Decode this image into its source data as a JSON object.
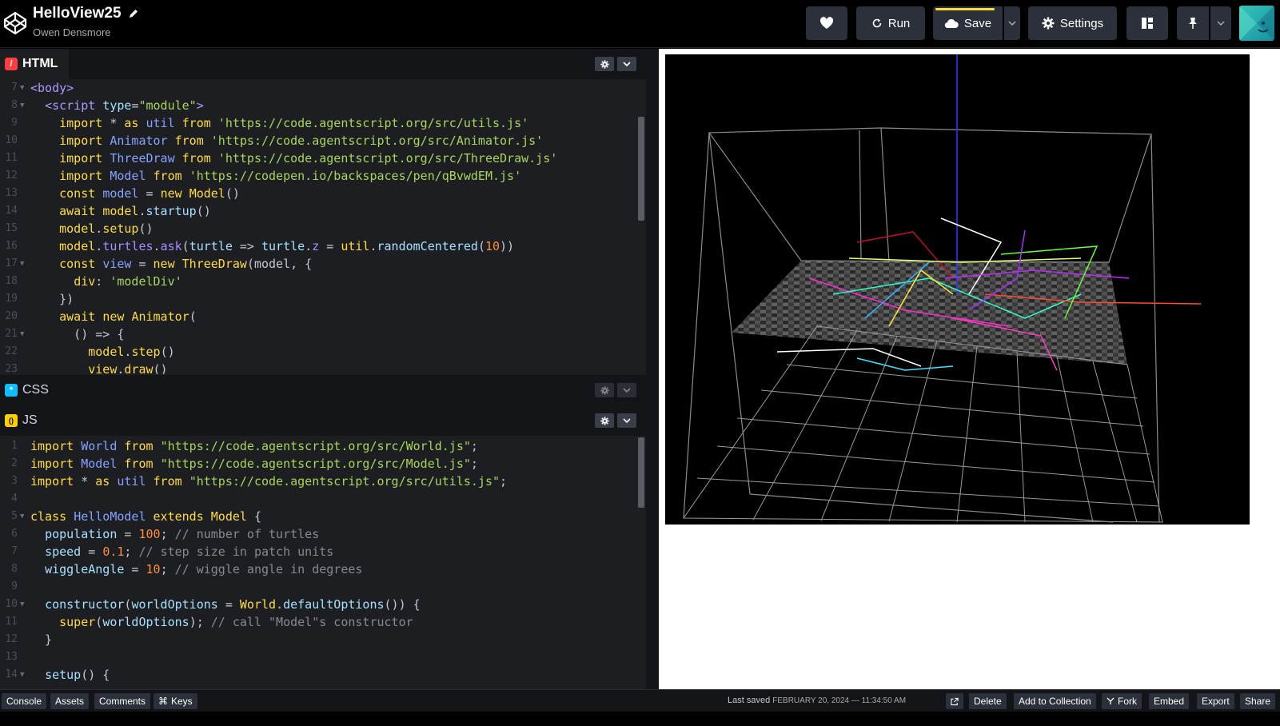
{
  "header": {
    "title": "HelloView25",
    "author": "Owen Densmore",
    "run_label": "Run",
    "save_label": "Save",
    "settings_label": "Settings"
  },
  "panes": {
    "html": {
      "label": "HTML",
      "badge": "/"
    },
    "css": {
      "label": "CSS",
      "badge": "*"
    },
    "js": {
      "label": "JS",
      "badge": "()"
    }
  },
  "html_lines": [
    {
      "n": "7",
      "fold": true,
      "t": [
        [
          "tg",
          "<body>"
        ]
      ]
    },
    {
      "n": "8",
      "fold": true,
      "t": [
        [
          "op",
          "  "
        ],
        [
          "tg",
          "<script "
        ],
        [
          "pr",
          "type"
        ],
        [
          "op",
          "="
        ],
        [
          "st",
          "\"module\""
        ],
        [
          "tg",
          ">"
        ]
      ]
    },
    {
      "n": "9",
      "t": [
        [
          "op",
          "    "
        ],
        [
          "kw",
          "import"
        ],
        [
          "op",
          " * "
        ],
        [
          "kw",
          "as"
        ],
        [
          "op",
          " "
        ],
        [
          "ty",
          "util"
        ],
        [
          "op",
          " "
        ],
        [
          "kw",
          "from"
        ],
        [
          "op",
          " "
        ],
        [
          "st",
          "'https://code.agentscript.org/src/utils.js'"
        ]
      ]
    },
    {
      "n": "10",
      "t": [
        [
          "op",
          "    "
        ],
        [
          "kw",
          "import"
        ],
        [
          "op",
          " "
        ],
        [
          "ty",
          "Animator"
        ],
        [
          "op",
          " "
        ],
        [
          "kw",
          "from"
        ],
        [
          "op",
          " "
        ],
        [
          "st",
          "'https://code.agentscript.org/src/Animator.js'"
        ]
      ]
    },
    {
      "n": "11",
      "t": [
        [
          "op",
          "    "
        ],
        [
          "kw",
          "import"
        ],
        [
          "op",
          " "
        ],
        [
          "ty",
          "ThreeDraw"
        ],
        [
          "op",
          " "
        ],
        [
          "kw",
          "from"
        ],
        [
          "op",
          " "
        ],
        [
          "st",
          "'https://code.agentscript.org/src/ThreeDraw.js'"
        ]
      ]
    },
    {
      "n": "12",
      "t": [
        [
          "op",
          "    "
        ],
        [
          "kw",
          "import"
        ],
        [
          "op",
          " "
        ],
        [
          "ty",
          "Model"
        ],
        [
          "op",
          " "
        ],
        [
          "kw",
          "from"
        ],
        [
          "op",
          " "
        ],
        [
          "st",
          "'https://codepen.io/backspaces/pen/qBvwdEM.js'"
        ]
      ]
    },
    {
      "n": "13",
      "t": [
        [
          "op",
          "    "
        ],
        [
          "kw",
          "const"
        ],
        [
          "op",
          " "
        ],
        [
          "ty",
          "model"
        ],
        [
          "op",
          " = "
        ],
        [
          "kw",
          "new"
        ],
        [
          "op",
          " "
        ],
        [
          "kw",
          "Model"
        ],
        [
          "op",
          "()"
        ]
      ]
    },
    {
      "n": "14",
      "t": [
        [
          "op",
          "    "
        ],
        [
          "kw",
          "await"
        ],
        [
          "op",
          " "
        ],
        [
          "kw",
          "model"
        ],
        [
          "op",
          "."
        ],
        [
          "pr",
          "startup"
        ],
        [
          "op",
          "()"
        ]
      ]
    },
    {
      "n": "15",
      "t": [
        [
          "op",
          "    "
        ],
        [
          "kw",
          "model"
        ],
        [
          "op",
          "."
        ],
        [
          "kw",
          "setup"
        ],
        [
          "op",
          "()"
        ]
      ]
    },
    {
      "n": "16",
      "t": [
        [
          "op",
          "    "
        ],
        [
          "kw",
          "model"
        ],
        [
          "op",
          "."
        ],
        [
          "id",
          "turtles"
        ],
        [
          "op",
          "."
        ],
        [
          "id",
          "ask"
        ],
        [
          "op",
          "("
        ],
        [
          "pr",
          "turtle"
        ],
        [
          "op",
          " => "
        ],
        [
          "pr",
          "turtle"
        ],
        [
          "op",
          "."
        ],
        [
          "id",
          "z"
        ],
        [
          "op",
          " = "
        ],
        [
          "kw",
          "util"
        ],
        [
          "op",
          "."
        ],
        [
          "pr",
          "randomCentered"
        ],
        [
          "op",
          "("
        ],
        [
          "nu",
          "10"
        ],
        [
          "op",
          "))"
        ]
      ]
    },
    {
      "n": "17",
      "fold": true,
      "t": [
        [
          "op",
          "    "
        ],
        [
          "kw",
          "const"
        ],
        [
          "op",
          " "
        ],
        [
          "ty",
          "view"
        ],
        [
          "op",
          " = "
        ],
        [
          "kw",
          "new"
        ],
        [
          "op",
          " "
        ],
        [
          "kw",
          "ThreeDraw"
        ],
        [
          "op",
          "(model, {"
        ]
      ]
    },
    {
      "n": "18",
      "t": [
        [
          "op",
          "      "
        ],
        [
          "kw",
          "div"
        ],
        [
          "op",
          ": "
        ],
        [
          "st",
          "'modelDiv'"
        ]
      ]
    },
    {
      "n": "19",
      "t": [
        [
          "op",
          "    })"
        ]
      ]
    },
    {
      "n": "20",
      "t": [
        [
          "op",
          "    "
        ],
        [
          "kw",
          "await"
        ],
        [
          "op",
          " "
        ],
        [
          "kw",
          "new"
        ],
        [
          "op",
          " "
        ],
        [
          "kw",
          "Animator"
        ],
        [
          "op",
          "("
        ]
      ]
    },
    {
      "n": "21",
      "fold": true,
      "t": [
        [
          "op",
          "      () => {"
        ]
      ]
    },
    {
      "n": "22",
      "t": [
        [
          "op",
          "        "
        ],
        [
          "kw",
          "model"
        ],
        [
          "op",
          "."
        ],
        [
          "kw",
          "step"
        ],
        [
          "op",
          "()"
        ]
      ]
    },
    {
      "n": "23",
      "t": [
        [
          "op",
          "        "
        ],
        [
          "kw",
          "view"
        ],
        [
          "op",
          "."
        ],
        [
          "kw",
          "draw"
        ],
        [
          "op",
          "()"
        ]
      ]
    }
  ],
  "js_lines": [
    {
      "n": "1",
      "t": [
        [
          "kw",
          "import"
        ],
        [
          "op",
          " "
        ],
        [
          "ty",
          "World"
        ],
        [
          "op",
          " "
        ],
        [
          "kw",
          "from"
        ],
        [
          "op",
          " "
        ],
        [
          "st",
          "\"https://code.agentscript.org/src/World.js\""
        ],
        [
          "op",
          ";"
        ]
      ]
    },
    {
      "n": "2",
      "t": [
        [
          "kw",
          "import"
        ],
        [
          "op",
          " "
        ],
        [
          "ty",
          "Model"
        ],
        [
          "op",
          " "
        ],
        [
          "kw",
          "from"
        ],
        [
          "op",
          " "
        ],
        [
          "st",
          "\"https://code.agentscript.org/src/Model.js\""
        ],
        [
          "op",
          ";"
        ]
      ]
    },
    {
      "n": "3",
      "t": [
        [
          "kw",
          "import"
        ],
        [
          "op",
          " * "
        ],
        [
          "kw",
          "as"
        ],
        [
          "op",
          " "
        ],
        [
          "ty",
          "util"
        ],
        [
          "op",
          " "
        ],
        [
          "kw",
          "from"
        ],
        [
          "op",
          " "
        ],
        [
          "st",
          "\"https://code.agentscript.org/src/utils.js\""
        ],
        [
          "op",
          ";"
        ]
      ]
    },
    {
      "n": "4",
      "t": []
    },
    {
      "n": "5",
      "fold": true,
      "t": [
        [
          "kw",
          "class"
        ],
        [
          "op",
          " "
        ],
        [
          "ty",
          "HelloModel"
        ],
        [
          "op",
          " "
        ],
        [
          "kw",
          "extends"
        ],
        [
          "op",
          " "
        ],
        [
          "kw",
          "Model"
        ],
        [
          "op",
          " {"
        ]
      ]
    },
    {
      "n": "6",
      "t": [
        [
          "op",
          "  "
        ],
        [
          "pr",
          "population"
        ],
        [
          "op",
          " = "
        ],
        [
          "nu",
          "100"
        ],
        [
          "op",
          "; "
        ],
        [
          "cm",
          "// number of turtles"
        ]
      ]
    },
    {
      "n": "7",
      "t": [
        [
          "op",
          "  "
        ],
        [
          "pr",
          "speed"
        ],
        [
          "op",
          " = "
        ],
        [
          "nu",
          "0.1"
        ],
        [
          "op",
          "; "
        ],
        [
          "cm",
          "// step size in patch units"
        ]
      ]
    },
    {
      "n": "8",
      "t": [
        [
          "op",
          "  "
        ],
        [
          "pr",
          "wiggleAngle"
        ],
        [
          "op",
          " = "
        ],
        [
          "nu",
          "10"
        ],
        [
          "op",
          "; "
        ],
        [
          "cm",
          "// wiggle angle in degrees"
        ]
      ]
    },
    {
      "n": "9",
      "t": []
    },
    {
      "n": "10",
      "fold": true,
      "t": [
        [
          "op",
          "  "
        ],
        [
          "pr",
          "constructor"
        ],
        [
          "op",
          "("
        ],
        [
          "pr",
          "worldOptions"
        ],
        [
          "op",
          " = "
        ],
        [
          "kw",
          "World"
        ],
        [
          "op",
          "."
        ],
        [
          "pr",
          "defaultOptions"
        ],
        [
          "op",
          "()) {"
        ]
      ]
    },
    {
      "n": "11",
      "t": [
        [
          "op",
          "    "
        ],
        [
          "kw",
          "super"
        ],
        [
          "op",
          "("
        ],
        [
          "pr",
          "worldOptions"
        ],
        [
          "op",
          "); "
        ],
        [
          "cm",
          "// call \"Model\"s constructor"
        ]
      ]
    },
    {
      "n": "12",
      "t": [
        [
          "op",
          "  }"
        ]
      ]
    },
    {
      "n": "13",
      "t": []
    },
    {
      "n": "14",
      "fold": true,
      "t": [
        [
          "op",
          "  "
        ],
        [
          "pr",
          "setup"
        ],
        [
          "op",
          "() {"
        ]
      ]
    }
  ],
  "footer": {
    "console": "Console",
    "assets": "Assets",
    "comments": "Comments",
    "keys": "Keys",
    "last_saved_label": "Last saved",
    "last_saved_date": "FEBRUARY 20, 2024 — 11:34:50 AM",
    "delete": "Delete",
    "add_to_collection": "Add to Collection",
    "fork": "Fork",
    "embed": "Embed",
    "export": "Export",
    "share": "Share"
  },
  "colors": {
    "accent_yellow": "#ffdd40",
    "html_badge": "#ff3c41",
    "css_badge": "#0ebeff",
    "js_badge": "#fcd000",
    "editor_bg": "#1d1e22",
    "button_bg": "#2c303a"
  }
}
